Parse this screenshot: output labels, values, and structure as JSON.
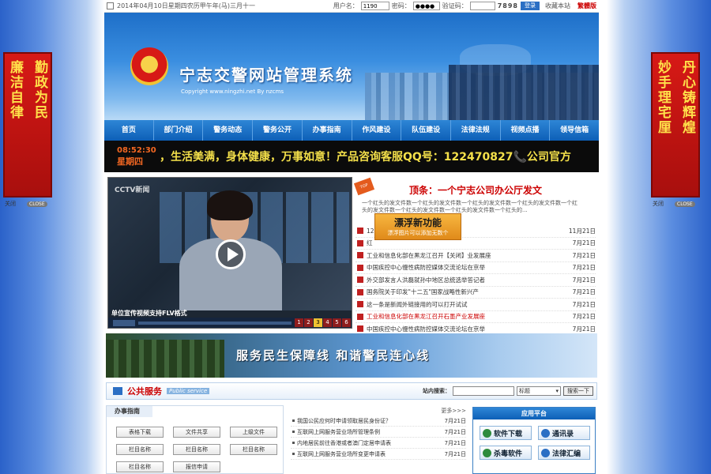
{
  "side_left": {
    "cols": [
      "廉洁自律",
      "勤政为民"
    ],
    "close_label": "关闭",
    "close_btn": "CLOSE"
  },
  "side_right": {
    "cols": [
      "妙手理宅厘",
      "丹心铸辉煌"
    ],
    "close_label": "关闭",
    "close_btn": "CLOSE"
  },
  "topbar": {
    "date": "2014年04月10日星期四农历甲午年(马)三月十一",
    "username_label": "用户名：",
    "username_value": "1190",
    "password_label": "密码：",
    "password_value": "●●●●",
    "captcha_label": "验证码：",
    "captcha_value": "",
    "captcha_code": "7898",
    "login_label": "登录",
    "bookmark_label": "收藏本站",
    "traditional_label": "繁體版"
  },
  "header": {
    "title": "宁志交警网站管理系统",
    "copyright": "Copyright  www.ningzhi.net By nzcms"
  },
  "nav": [
    "首页",
    "部门介绍",
    "警务动态",
    "警务公开",
    "办事指南",
    "作风建设",
    "队伍建设",
    "法律法规",
    "视频点播",
    "领导信箱"
  ],
  "ticker": {
    "time": "08:52:30",
    "weekday": "星期四",
    "message": "，生活美满，身体健康，万事如意！产品咨询客服QQ号：122470827📞公司官方"
  },
  "video": {
    "logo": "CCTV新闻",
    "caption": "单位宣传视频支持FLV格式",
    "pages": [
      "1",
      "2",
      "3",
      "4",
      "5",
      "6"
    ]
  },
  "news": {
    "badge": "TOP NEWS",
    "headline": "顶条：一个宁志公司办公厅发文",
    "summary": "一个红头的发文件数一个红头的发文件数一个红头的发文件数一个红头的发文件数一个红头的发文件数一个红头的发文件数一个红头的发文件数一个红头的...",
    "items": [
      {
        "text": "12",
        "date": "11月21日",
        "red": false
      },
      {
        "text": "红",
        "date": "7月21日",
        "red": false
      },
      {
        "text": "工业和信息化部在黑龙江召开【关闭】业发展座",
        "date": "7月21日",
        "red": false
      },
      {
        "text": "中国疾控中心慢性病防控媒体交流论坛在京举",
        "date": "7月21日",
        "red": false
      },
      {
        "text": "外交部发言人洪磊就孙中地区总统选举答记者",
        "date": "7月21日",
        "red": false
      },
      {
        "text": "国务院关于印发\"十二五\"国家战略性新兴产",
        "date": "7月21日",
        "red": false
      },
      {
        "text": "这一条是新闻外链接用的可以打开试试",
        "date": "7月21日",
        "red": false
      },
      {
        "text": "工业和信息化部在黑龙江召开石墨产业发展座",
        "date": "7月21日",
        "red": true
      },
      {
        "text": "中国疾控中心慢性病防控媒体交流论坛在京举",
        "date": "7月21日",
        "red": false
      }
    ]
  },
  "popup": {
    "title": "漂浮新功能",
    "sub": "漂浮图片可以添加无数个"
  },
  "banner2": {
    "slogan": "服务民生保障线  和谐警民连心线"
  },
  "services": {
    "title": "公共服务",
    "subtitle": "Public service",
    "search_label": "站内搜索：",
    "select_value": "标题",
    "search_btn": "搜索一下"
  },
  "guide": {
    "title": "办事指南",
    "buttons": [
      "表格下载",
      "文件共享",
      "上级文件",
      "栏目名称",
      "栏目名称",
      "栏目名称",
      "栏目名称",
      "报信申请"
    ]
  },
  "list2": {
    "more": "更多>>>",
    "items": [
      {
        "text": "我国公民应何时申请领取居民身份证？",
        "date": "7月21日"
      },
      {
        "text": "互联网上网服务营业场所管理条例",
        "date": "7月21日"
      },
      {
        "text": "内地居民前往香港或者澳门定居申请表",
        "date": "7月21日"
      },
      {
        "text": "互联网上网服务营业场所变更申请表",
        "date": "7月21日"
      }
    ]
  },
  "apps": {
    "title": "应用平台",
    "items": [
      "软件下载",
      "通讯录",
      "杀毒软件",
      "法律汇编"
    ]
  }
}
